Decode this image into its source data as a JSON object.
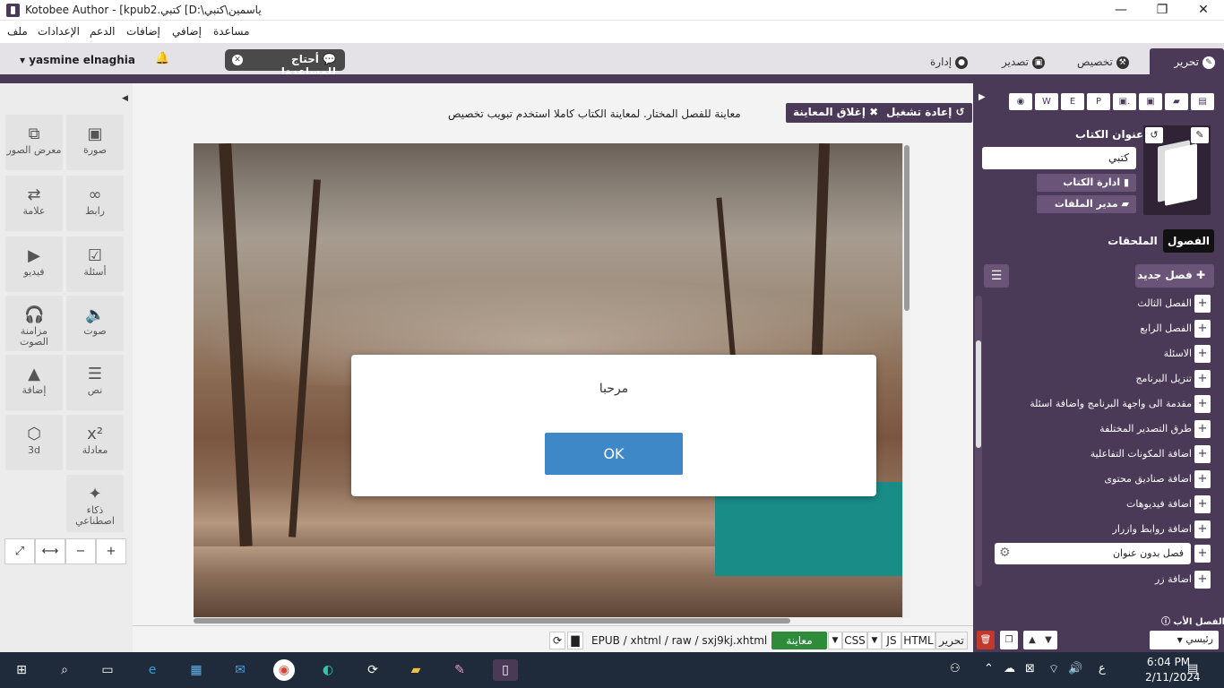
{
  "window": {
    "title": "Kotobee Author - [kpub2.كتبي [D:\\ياسمين\\كتبي",
    "minimize": "—",
    "maximize": "❐",
    "close": "✕"
  },
  "menu": {
    "items": [
      "ملف",
      "الإعدادات",
      "الدعم",
      "إضافات",
      "إضافي",
      "مساعدة"
    ]
  },
  "toolbar": {
    "tabs": [
      {
        "label": "تحرير",
        "icon": "pencil-icon"
      },
      {
        "label": "تخصيص",
        "icon": "wrench-icon"
      },
      {
        "label": "تصدير",
        "icon": "export-icon"
      },
      {
        "label": "إدارة",
        "icon": "user-icon"
      }
    ],
    "help_label": "أحتاج للمساعدة!",
    "username": "yasmine elnaghia"
  },
  "tools": [
    {
      "label": "صورة",
      "icon": "image-icon",
      "glyph": "▣"
    },
    {
      "label": "معرض الصور",
      "icon": "gallery-icon",
      "glyph": "⧉"
    },
    {
      "label": "رابط",
      "icon": "link-icon",
      "glyph": "∞"
    },
    {
      "label": "علامة",
      "icon": "bookmark-icon",
      "glyph": "⇄"
    },
    {
      "label": "أسئلة",
      "icon": "questions-icon",
      "glyph": "☑"
    },
    {
      "label": "فيديو",
      "icon": "video-icon",
      "glyph": "▶"
    },
    {
      "label": "صوت",
      "icon": "audio-icon",
      "glyph": "🔈"
    },
    {
      "label": "مزامنة الصوت",
      "icon": "audio-sync-icon",
      "glyph": "🎧"
    },
    {
      "label": "نص",
      "icon": "text-icon",
      "glyph": "☰"
    },
    {
      "label": "إضافة",
      "icon": "shapes-icon",
      "glyph": "▲"
    },
    {
      "label": "معادلة",
      "icon": "equation-icon",
      "glyph": "x²"
    },
    {
      "label": "3d",
      "icon": "cube-icon",
      "glyph": "⬡"
    },
    {
      "label": "ذكاء اصطناعي",
      "icon": "ai-wand-icon",
      "glyph": "✦"
    }
  ],
  "zoom": [
    "⤢",
    "⟷",
    "−",
    "+"
  ],
  "preview": {
    "message": "معاينة للفصل المختار. لمعاينة الكتاب كاملا استخدم تبويب تخصيص",
    "close_label": "إغلاق المعاينة",
    "replay_label": "إعادة تشغيل"
  },
  "dialog": {
    "message": "مرحبا",
    "ok_label": "OK"
  },
  "bottom": {
    "path": "EPUB / xhtml / raw / sxj9kj.xhtml",
    "preview_label": "معاينة",
    "css_label": "CSS",
    "js_label": "JS",
    "html_label": "HTML",
    "edit_label": "تحرير"
  },
  "book": {
    "title_label": "عنوان الكتاب",
    "title_value": "كتبي",
    "manage_label": "ادارة الكتاب",
    "files_label": "مدير الملفات"
  },
  "chapters": {
    "tab_chapters": "الفصول",
    "tab_appendices": "الملحقات",
    "new_chapter": "فصل جديد",
    "items": [
      "الفصل الثالث",
      "الفصل الرابع",
      "الاسئلة",
      "تنزيل البرنامج",
      "مقدمة الى واجهة البرنامج واضافة اسئلة",
      "طرق التصدير المختلفة",
      "اضافة المكونات التفاعلية",
      "اضافة صناديق محتوى",
      "اضافة فيديوهات",
      "اضافة روابط وازرار"
    ],
    "selected_placeholder": "فصل بدون عنوان",
    "last_item": "اضافة زر",
    "parent_label": "الفصل الأب",
    "parent_value": "رئيسي"
  },
  "taskbar": {
    "time": "6:04 PM",
    "date": "2/11/2024",
    "lang": "ع"
  },
  "colors": {
    "accent": "#4b3a57",
    "ok_button": "#3f88c8",
    "preview_green": "#2e8b3a",
    "teal_block": "#1a8c88"
  }
}
